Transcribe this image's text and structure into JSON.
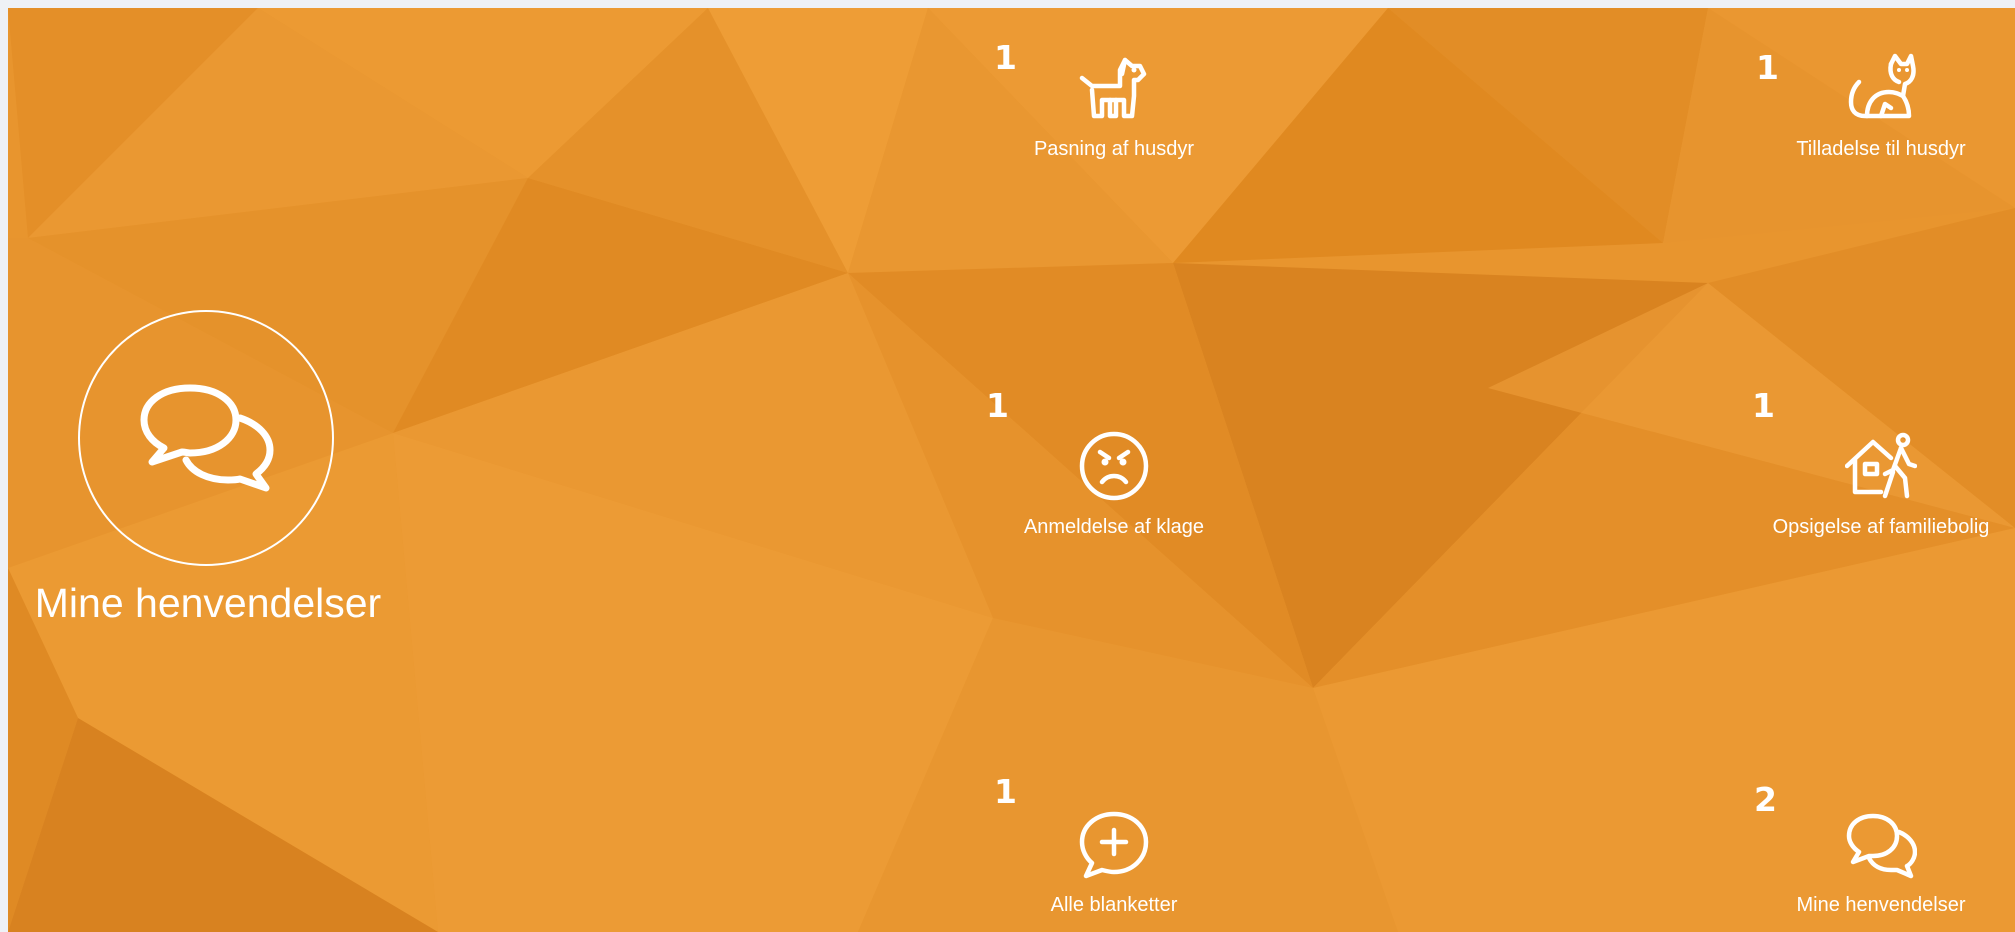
{
  "colors": {
    "background_base": "#e8952e",
    "foreground": "#ffffff"
  },
  "hero": {
    "icon": "chat-bubbles-icon",
    "label": "Mine henvendelser"
  },
  "tiles": [
    {
      "label": "Pasning af husdyr",
      "icon": "dog-icon",
      "count": "1"
    },
    {
      "label": "Tilladelse til husdyr",
      "icon": "cat-icon",
      "count": "1"
    },
    {
      "label": "Anmeldelse af klage",
      "icon": "angry-face-icon",
      "count": "1"
    },
    {
      "label": "Opsigelse af familiebolig",
      "icon": "house-leaving-icon",
      "count": "1"
    },
    {
      "label": "Alle blanketter",
      "icon": "chat-plus-icon",
      "count": "1"
    },
    {
      "label": "Mine henvendelser",
      "icon": "chat-bubbles-icon",
      "count": "2"
    }
  ]
}
